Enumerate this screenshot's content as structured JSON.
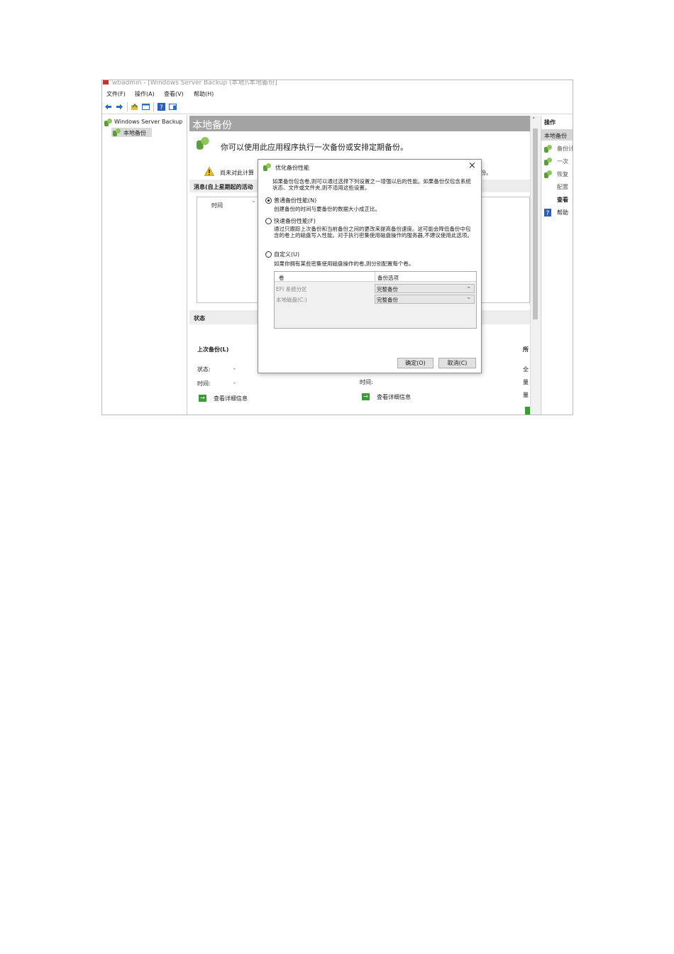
{
  "window": {
    "title": "wbadmin - [Windows Server Backup (本地)\\本地备份]"
  },
  "menu": {
    "file": "文件(F)",
    "action": "操作(A)",
    "view": "查看(V)",
    "help": "帮助(H)"
  },
  "tree": {
    "root": "Windows Server Backup",
    "child": "本地备份"
  },
  "center": {
    "header": "本地备份",
    "intro": "你可以使用此应用程序执行一次备份或安排定期备份。",
    "warning_left": "尚未对此计算",
    "warning_right": "份。",
    "messages_title": "消息(自上星期起的活动",
    "col_time": "时间",
    "status_title": "状态",
    "last_backup": "上次备份(L)",
    "status_label": "状态:",
    "status_value": "-",
    "time_label": "时间:",
    "time_value": "-",
    "time_label_2": "时间:",
    "view_details": "查看详细信息",
    "view_details_2": "查看详细信息",
    "right_col": [
      "所",
      "全",
      "量",
      "量"
    ]
  },
  "actions": {
    "title": "操作",
    "section": "本地备份",
    "items": [
      "备份计",
      "一次",
      "恢复",
      "配置",
      "查看",
      "帮助"
    ]
  },
  "dialog": {
    "title": "优化备份性能",
    "close": "×",
    "description": "如果备份包含卷,则可以通过选择下列设置之一增强以后的性能。如果备份仅包含系统状态、文件或文件夹,则不适用这些设置。",
    "options": [
      {
        "label": "普通备份性能(N)",
        "desc": "创建备份的时间与要备份的数据大小成正比。",
        "selected": true
      },
      {
        "label": "快速备份性能(F)",
        "desc": "通过只跟踪上次备份和当前备份之间的更改来提高备份速度。这可能会降低备份中包含的卷上的磁盘写入性能。对于执行密集使用磁盘操作的服务器,不建议使用此选项。",
        "selected": false
      },
      {
        "label": "自定义(U)",
        "desc": "如果你拥有某些密集使用磁盘操作的卷,则分别配置每个卷。",
        "selected": false
      }
    ],
    "table": {
      "headers": [
        "卷",
        "备份选项"
      ],
      "rows": [
        {
          "volume": "EFI 系统分区",
          "option": "完整备份"
        },
        {
          "volume": "本地磁盘(C:)",
          "option": "完整备份"
        }
      ]
    },
    "ok": "确定(O)",
    "cancel": "取消(C)"
  }
}
